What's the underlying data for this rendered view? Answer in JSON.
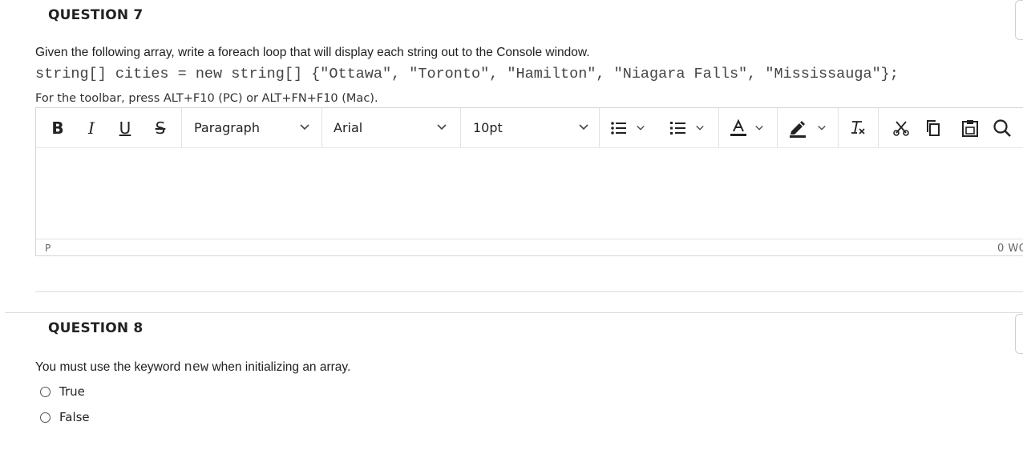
{
  "q7": {
    "title": "QUESTION 7",
    "prompt": "Given the following array, write a foreach loop that will display each string out to the Console window.",
    "code": "string[] cities = new string[] {\"Ottawa\", \"Toronto\", \"Hamilton\", \"Niagara Falls\", \"Mississauga\"};",
    "toolbar_hint": "For the toolbar, press ALT+F10 (PC) or ALT+FN+F10 (Mac)."
  },
  "editor": {
    "buttons": {
      "bold": "B",
      "italic": "I",
      "underline": "U",
      "strikethrough": "S"
    },
    "block_format": "Paragraph",
    "font_family": "Arial",
    "font_size": "10pt",
    "content": "",
    "status_path": "P",
    "word_count": "0 WO",
    "icons": [
      "bullet-list-icon",
      "numbered-list-icon",
      "text-color-icon",
      "highlight-icon",
      "clear-formatting-icon",
      "cut-icon",
      "copy-icon",
      "paste-icon",
      "search-icon"
    ]
  },
  "q8": {
    "title": "QUESTION 8",
    "prompt_before": "You must use the keyword ",
    "keyword": "new",
    "prompt_after": " when initializing an array.",
    "options": [
      "True",
      "False"
    ]
  }
}
